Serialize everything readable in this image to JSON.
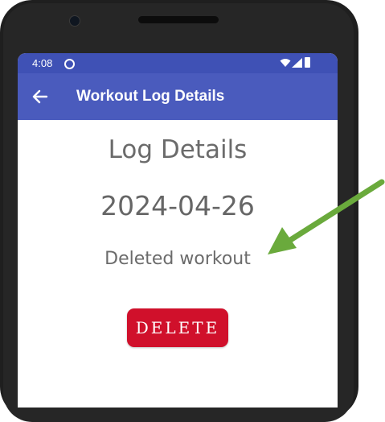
{
  "status_bar": {
    "time": "4:08",
    "icons": [
      "circle-indicator-icon",
      "wifi-icon",
      "signal-icon",
      "battery-icon"
    ]
  },
  "app_bar": {
    "title": "Workout Log Details",
    "back_icon": "arrow-back-icon"
  },
  "content": {
    "heading": "Log Details",
    "date": "2024-04-26",
    "notes": "Deleted workout"
  },
  "actions": {
    "delete_label": "DELETE"
  },
  "annotation": {
    "arrow_icon": "green-arrow-icon"
  },
  "colors": {
    "status_bar": "#3f51b5",
    "app_bar": "#4a5bbd",
    "delete_button": "#d0102b",
    "annotation_arrow": "#6aaa3c",
    "phone_frame": "#1f1f1f"
  }
}
